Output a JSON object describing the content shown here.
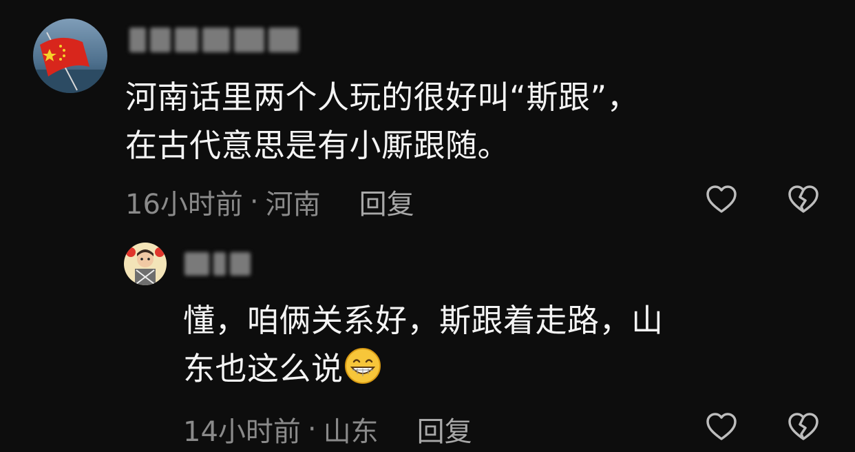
{
  "comments": [
    {
      "text_line1": "河南话里两个人玩的很好叫“斯跟”，",
      "text_line2": "在古代意思是有小厮跟随。",
      "time": "16小时前",
      "separator": "·",
      "location": "河南",
      "reply_label": "回复",
      "avatar_icon": "china-flag-avatar",
      "like_icon": "heart-outline-icon",
      "dislike_icon": "broken-heart-icon"
    },
    {
      "text_line1": "懂，咱俩关系好，斯跟着走路，山",
      "text_line2": "东也这么说",
      "emoji": "grinning-face-emoji",
      "time": "14小时前",
      "separator": "·",
      "location": "山东",
      "reply_label": "回复",
      "avatar_icon": "child-photo-avatar",
      "like_icon": "heart-outline-icon",
      "dislike_icon": "broken-heart-icon"
    }
  ],
  "colors": {
    "background": "#0d0d0d",
    "text": "#f4f4f4",
    "meta": "#8a8a8a",
    "icon": "#bdbdbd"
  }
}
